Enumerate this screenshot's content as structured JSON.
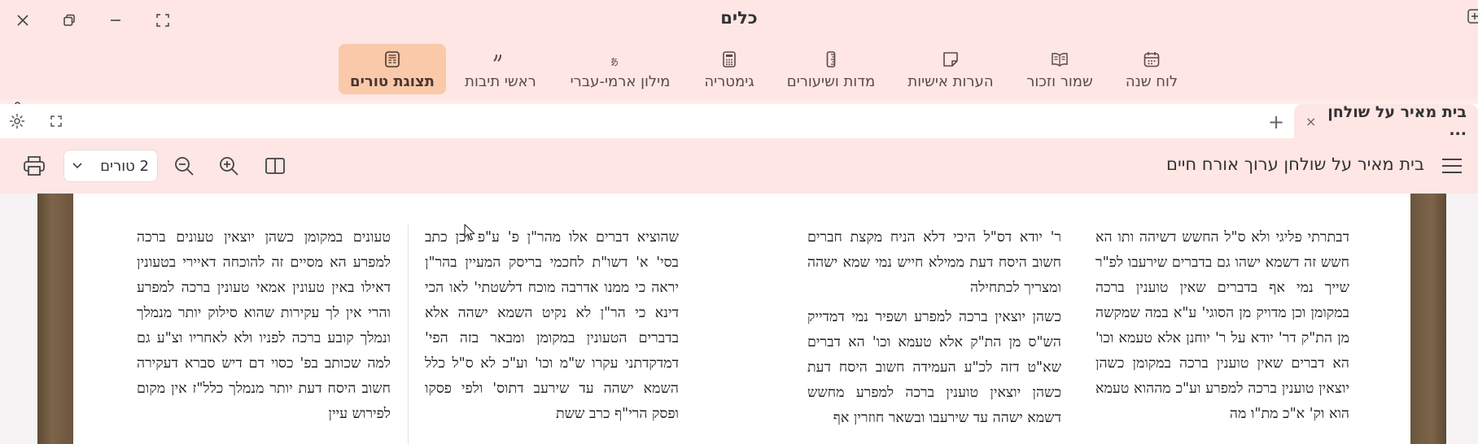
{
  "window": {
    "title": "כלים",
    "controls": [
      "close-icon",
      "restore-icon",
      "minimize-icon",
      "fullscreen-icon"
    ]
  },
  "tools": [
    {
      "label": "לוח שנה",
      "icon": "calendar-icon"
    },
    {
      "label": "שמור וזכור",
      "icon": "book-open-icon"
    },
    {
      "label": "הערות אישיות",
      "icon": "note-icon"
    },
    {
      "label": "מדות ושיעורים",
      "icon": "ruler-icon"
    },
    {
      "label": "גימטריה",
      "icon": "calculator-icon"
    },
    {
      "label": "מילון ארמי-עברי",
      "icon": "translate-icon"
    },
    {
      "label": "ראשי תיבות",
      "icon": "quote-icon"
    },
    {
      "label": "תצוגת טורים",
      "icon": "columns-doc-icon",
      "active": true
    }
  ],
  "tab": {
    "label": "בית מאיר על שולחן ...",
    "close": "×",
    "add": "+"
  },
  "book_toolbar": {
    "title": "בית מאיר על שולחן ערוך אורח חיים",
    "columns_select": "2 טורים"
  },
  "text_columns": [
    {
      "paragraphs": [
        "דבתרתי פליגי ולא ס\"ל החשש דשיהה ותו הא חשש זה דשמא ישהו גם בדברים שירעבו לפ\"ר שייך נמי אף בדברים שאין טוענין ברכה במקומן וכן מדויק מן הסוגי' ע\"א במה שמקשה מן הת\"ק דר' יודא על ר' יוחנן אלא טעמא וכו' הא דברים שאין טוענין ברכה במקומן כשהן יוצאין טוענין ברכה למפרע וע\"כ מההוא טעמא הוא וק' א\"כ מת\"ו מה"
      ]
    },
    {
      "paragraphs": [
        "ר' יודא דס\"ל היכי דלא הניח מקצת חברים חשוב היסח דעת ממילא חייש נמי שמא ישהה ומצריך לכתחילה",
        "כשהן יוצאין ברכה למפרע ושפיר נמי דמדייק הש\"ס מן הת\"ק אלא טעמא וכו' הא דברים שא\"ט דזה לכ\"ע העמידה חשוב היסח דעת כשהן יוצאין טוענין ברכה למפרע מחשש דשמא ישהה עד שירעבו ובשאר חוזרין אף"
      ]
    },
    {
      "paragraphs": [
        "שהוציא דברים אלו מהר\"ן פ' ע\"פ וכן כתב בסי' א' דשו\"ת לחכמי בריסק המעיין בהר\"ן יראה כי ממנו אדרבה מוכח דלשטתי' לאו הכי דינא כי הר\"ן לא נקיט השמא ישהה אלא בדברים הטעונין במקומן ומבאר בזה הפי' דמדקדתני עקרו ש\"מ וכו' וע\"כ לא ס\"ל כלל השמא ישהה עד שירעב דתוס' ולפי פסקו ופסק הרי\"ף כרב ששת"
      ]
    },
    {
      "paragraphs": [
        "טעונים במקומן כשהן יוצאין טעונים ברכה למפרע הא מסיים זה להוכחה דאיירי בטעונין דאילו באין טעונין אמאי טעונין ברכה למפרע והרי אין לך עקירות שהוא סילוק יותר מנמלך ונמלך קובע ברכה לפניו ולא לאחריו וצ\"ע גם למה שכותב בפ' כסוי דם דיש סברא דעקירה חשוב היסח דעת יותר מנמלך כלל\"ז אין מקום לפירוש עיין"
      ]
    }
  ]
}
